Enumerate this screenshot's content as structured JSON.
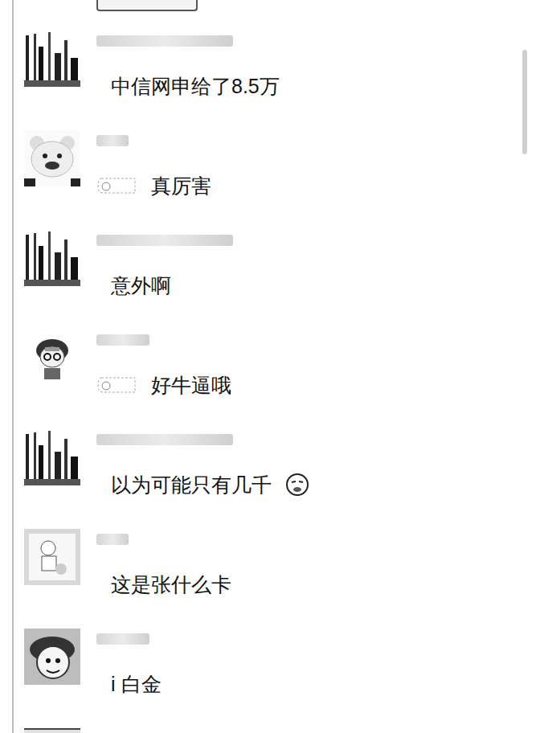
{
  "messages": [
    {
      "avatar": "skyline",
      "kind": "text",
      "text": "中信网申给了8.5万"
    },
    {
      "avatar": "bear",
      "kind": "emoji-prefix",
      "text": "真厉害"
    },
    {
      "avatar": "skyline",
      "kind": "text",
      "text": "意外啊"
    },
    {
      "avatar": "glasses-boy",
      "kind": "emoji-prefix",
      "text": "好牛逼哦"
    },
    {
      "avatar": "skyline",
      "kind": "emoji-suffix",
      "text": "以为可能只有几千"
    },
    {
      "avatar": "child",
      "kind": "text",
      "text": "这是张什么卡"
    },
    {
      "avatar": "cartoon",
      "kind": "text",
      "text": "i 白金"
    }
  ]
}
